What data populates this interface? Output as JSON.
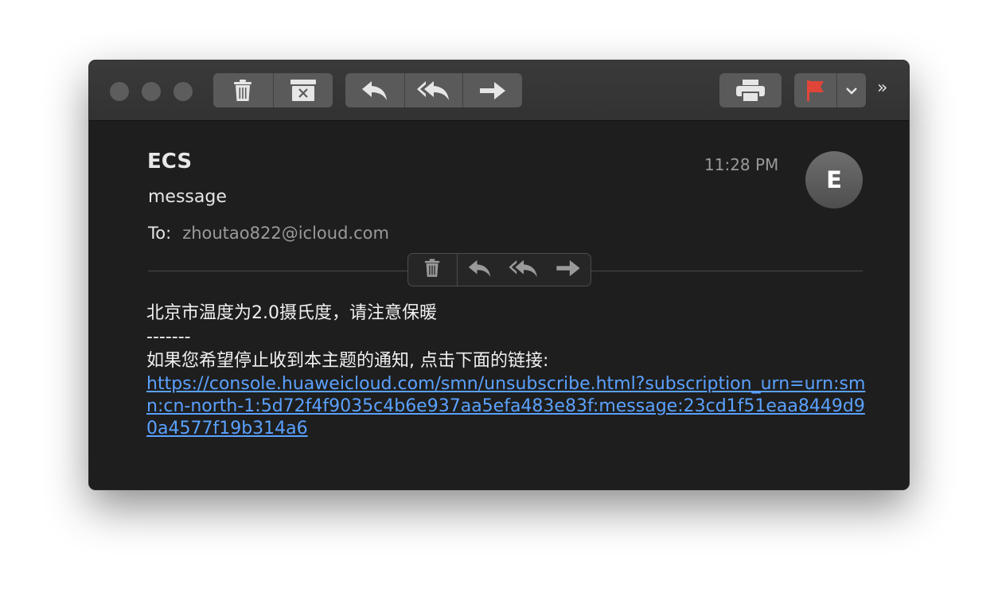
{
  "toolbar": {
    "buttons": {
      "delete": "trash-icon",
      "junk": "junk-box-icon",
      "reply": "reply-icon",
      "reply_all": "reply-all-icon",
      "forward": "forward-icon",
      "print": "print-icon",
      "flag": "flag-icon",
      "flag_menu": "chevron-down-icon",
      "more": "»"
    },
    "flag_color": "#e0453a"
  },
  "message": {
    "sender": "ECS",
    "subject": "message",
    "time": "11:28 PM",
    "avatar_initial": "E",
    "to_label": "To:",
    "to_address": "zhoutao822@icloud.com",
    "body_line1": "北京市温度为2.0摄氏度，请注意保暖",
    "body_line2": "-------",
    "body_line3": "如果您希望停止收到本主题的通知, 点击下面的链接:",
    "link": "https://console.huaweicloud.com/smn/unsubscribe.html?subscription_urn=urn:smn:cn-north-1:5d72f4f9035c4b6e937aa5efa483e83f:message:23cd1f51eaa8449d90a4577f19b314a6"
  },
  "colors": {
    "link": "#5aa1ff",
    "window_bg": "#1e1e1e",
    "toolbar_bg": "#353535"
  }
}
